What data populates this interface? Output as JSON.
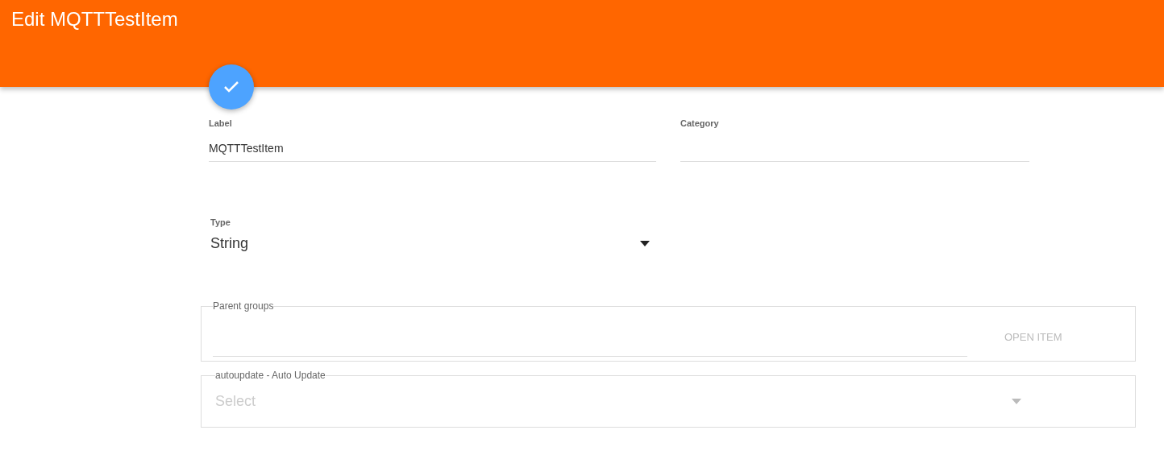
{
  "header": {
    "title": "Edit MQTTTestItem"
  },
  "form": {
    "label": {
      "label": "Label",
      "value": "MQTTTestItem"
    },
    "category": {
      "label": "Category"
    },
    "type": {
      "label": "Type",
      "value": "String"
    }
  },
  "parent_groups": {
    "legend": "Parent groups",
    "button": {
      "label": "OPEN ITEM",
      "disabled": true
    }
  },
  "autoupdate": {
    "legend": "autoupdate - Auto Update",
    "placeholder": "Select"
  }
}
